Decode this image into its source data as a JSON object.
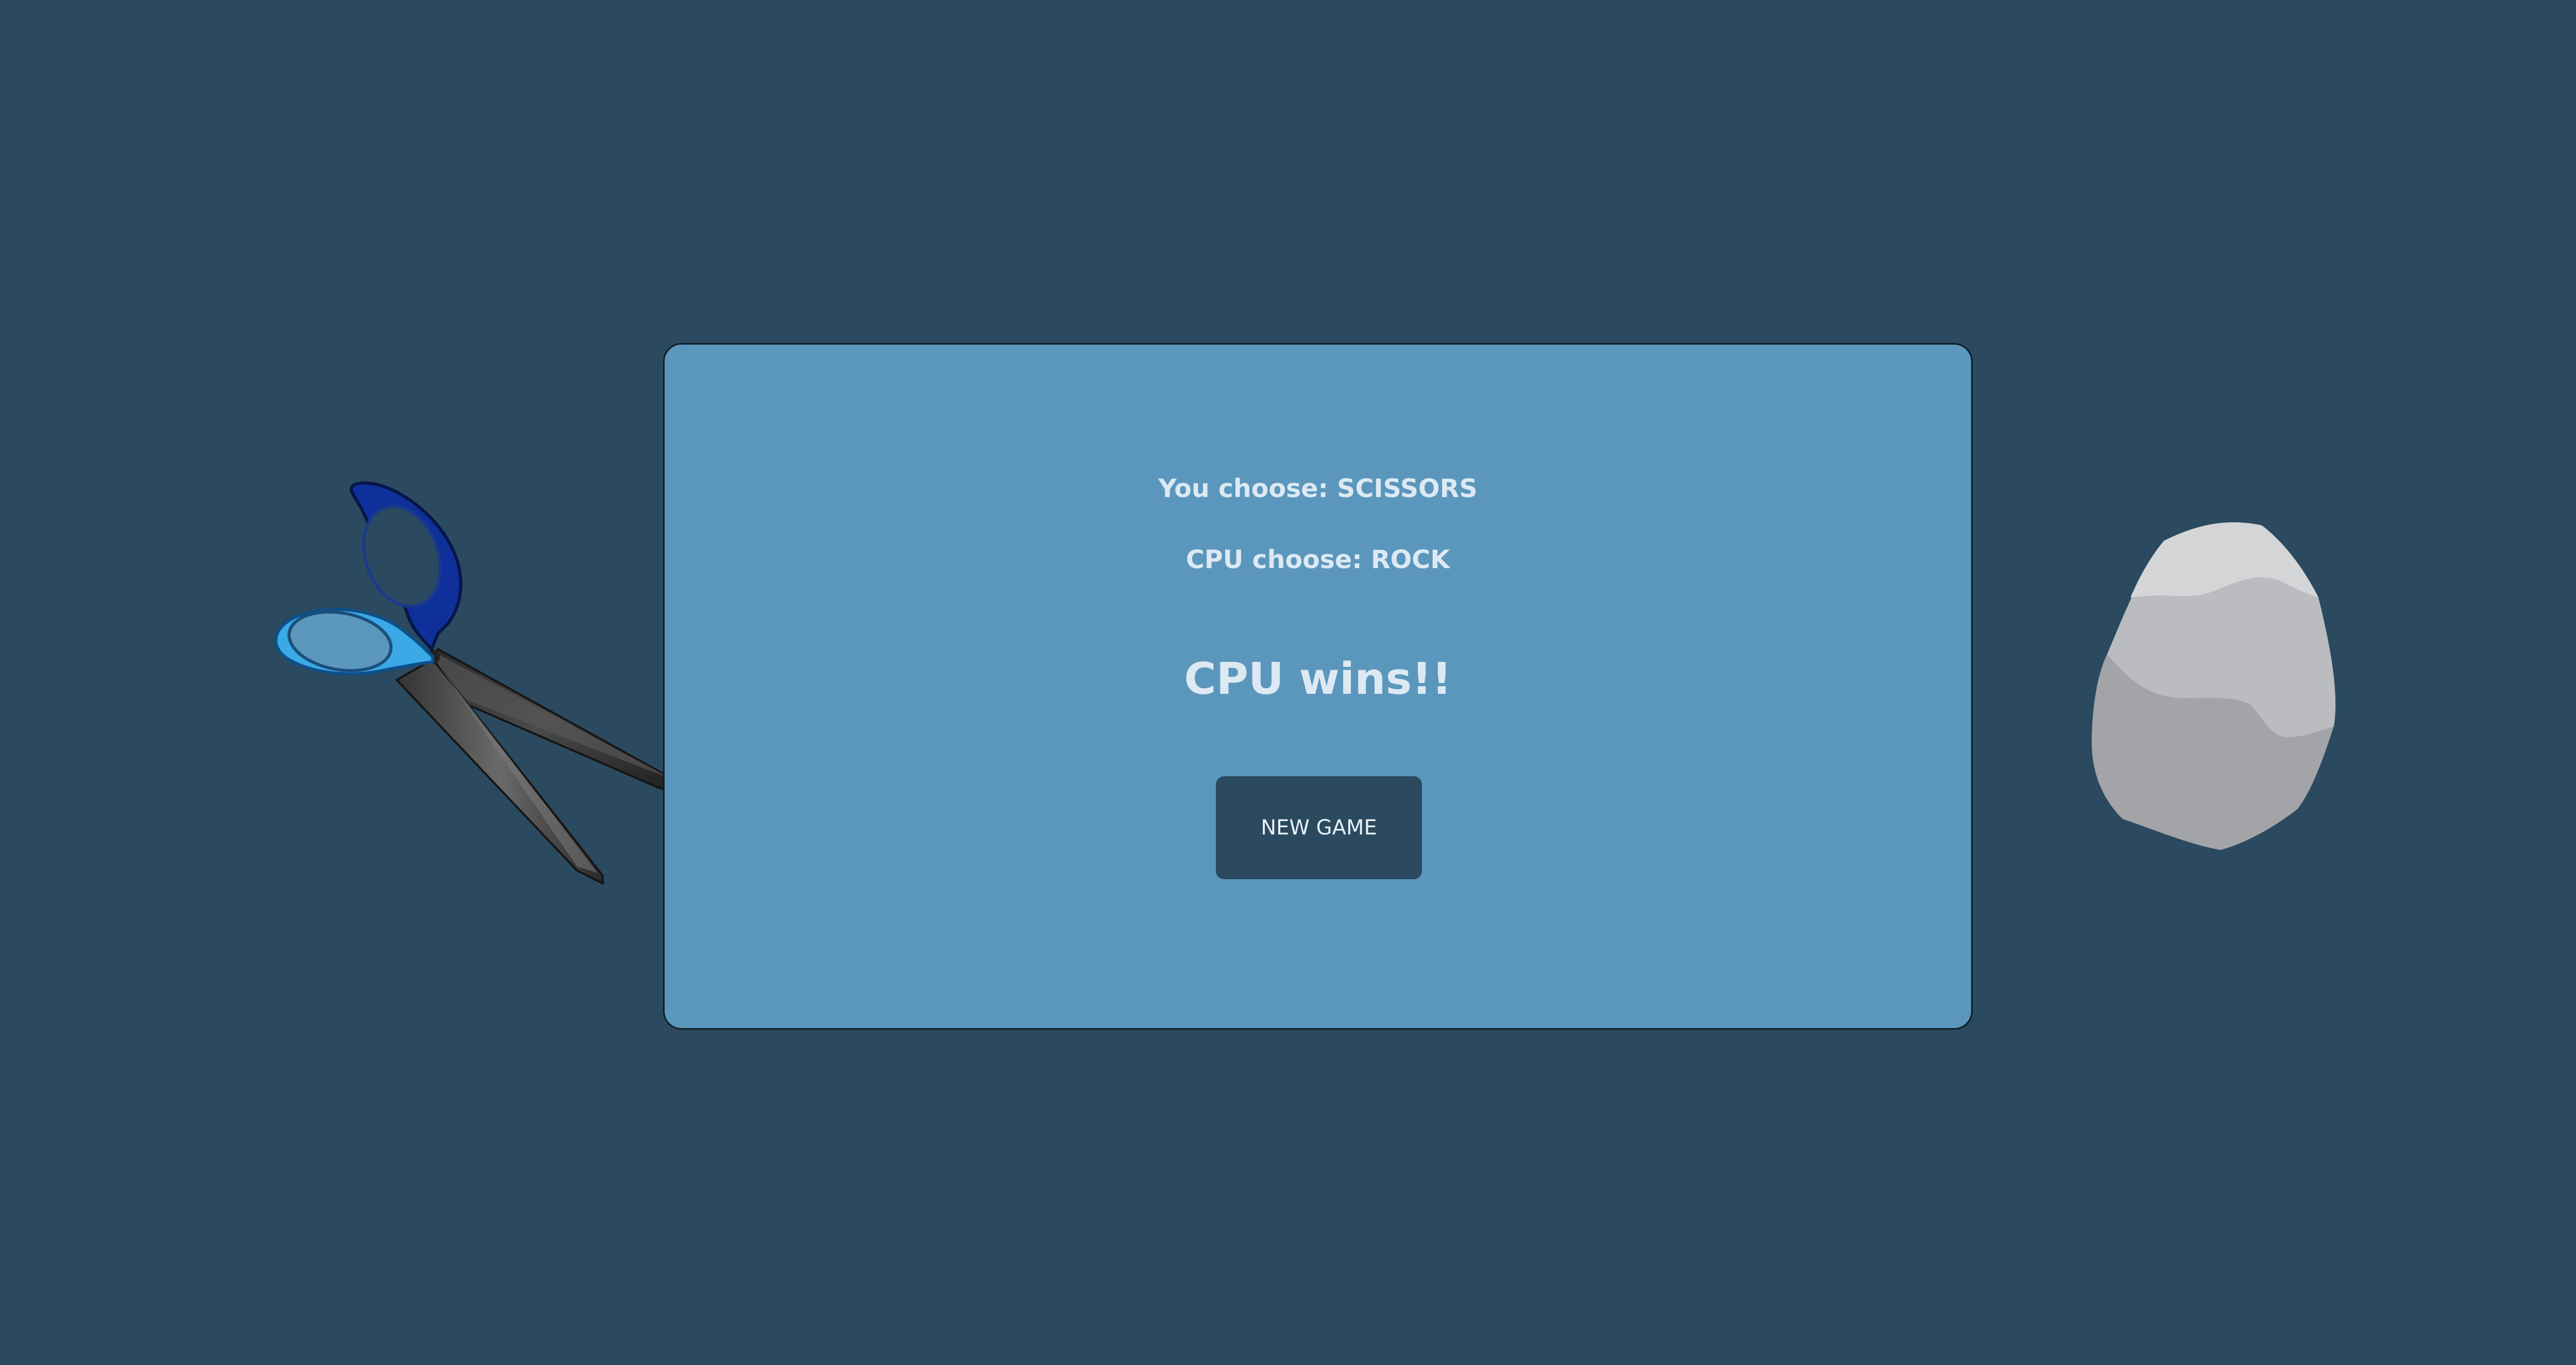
{
  "game": {
    "player_choice_text": "You choose: SCISSORS",
    "cpu_choice_text": "CPU choose: ROCK",
    "result_text": "CPU wins!!",
    "new_game_label": "NEW GAME"
  },
  "icons": {
    "player_hand": "scissors-icon",
    "cpu_hand": "rock-icon"
  },
  "colors": {
    "background": "#2b4a5f",
    "panel": "#5b97bd",
    "text": "#dce9f3",
    "button": "#2b4a5f"
  }
}
